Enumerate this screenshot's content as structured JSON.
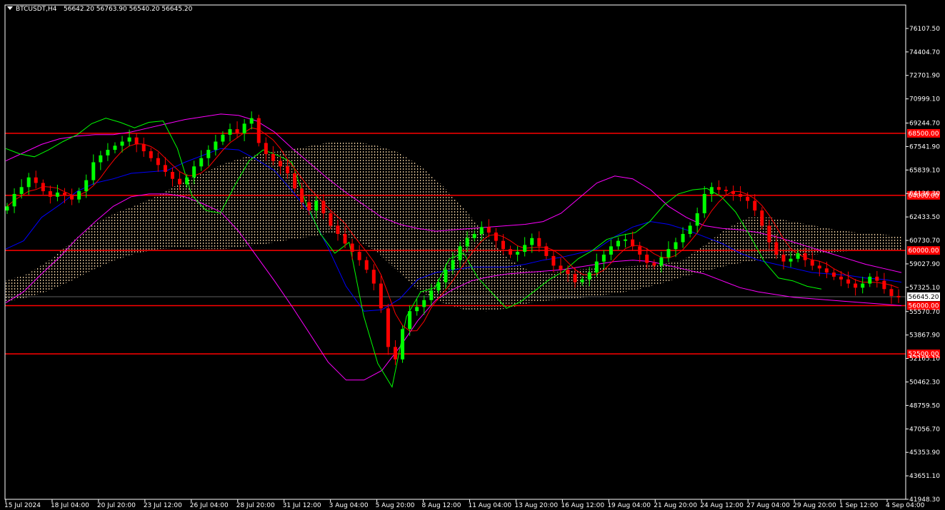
{
  "header": {
    "symbol": "BTCUSDT,H4",
    "ohlc": "56642.20 56763.90 56540.20 56645.20"
  },
  "colors": {
    "background": "#000000",
    "axis": "#ffffff",
    "bull_candle": "#00ff00",
    "bear_candle": "#ff0000",
    "level_line": "#ff0000",
    "bollinger": "#ff00ff",
    "kijun": "#0000ff",
    "tenkan": "#ff0000",
    "chikou": "#00ff00",
    "kumo": "#ffdead"
  },
  "chart_data": {
    "type": "candlestick",
    "ylim": [
      41948.3,
      77810.2
    ],
    "y_ticks": [
      "76107.50",
      "74404.70",
      "72701.90",
      "70999.10",
      "69244.70",
      "67541.90",
      "65839.10",
      "64136.30",
      "62433.50",
      "60730.70",
      "59027.90",
      "57325.10",
      "55570.70",
      "53867.90",
      "52165.10",
      "50462.30",
      "48759.50",
      "47056.70",
      "45353.90",
      "43651.10",
      "41948.30"
    ],
    "x_ticks": [
      "15 Jul 2024",
      "18 Jul 04:00",
      "20 Jul 20:00",
      "23 Jul 12:00",
      "26 Jul 04:00",
      "28 Jul 20:00",
      "31 Jul 12:00",
      "3 Aug 04:00",
      "5 Aug 20:00",
      "8 Aug 12:00",
      "11 Aug 04:00",
      "13 Aug 20:00",
      "16 Aug 12:00",
      "19 Aug 04:00",
      "21 Aug 20:00",
      "24 Aug 12:00",
      "27 Aug 04:00",
      "29 Aug 20:00",
      "1 Sep 12:00",
      "4 Sep 04:00"
    ],
    "levels": [
      {
        "label": "68500.00",
        "value": 68500
      },
      {
        "label": "64000.00",
        "value": 64000
      },
      {
        "label": "60000.00",
        "value": 60000
      },
      {
        "label": "56000.00",
        "value": 56000
      },
      {
        "label": "52500.00",
        "value": 52500
      }
    ],
    "current_price": {
      "label": "56645.20",
      "value": 56645.2
    },
    "close_series": [
      63200,
      64100,
      64600,
      65300,
      64900,
      64300,
      63900,
      64200,
      64000,
      63700,
      64300,
      65100,
      66400,
      66900,
      67300,
      67600,
      67900,
      68200,
      67700,
      67200,
      66700,
      66200,
      65700,
      65200,
      64800,
      65300,
      66100,
      66700,
      67300,
      67900,
      68400,
      68800,
      68500,
      69200,
      69600,
      67800,
      67000,
      66500,
      66100,
      65600,
      64500,
      63500,
      62900,
      63600,
      62700,
      61800,
      61200,
      60500,
      59900,
      59300,
      58600,
      57600,
      55800,
      53000,
      52100,
      54300,
      55600,
      55900,
      56400,
      57100,
      57700,
      58600,
      59300,
      60300,
      60900,
      61200,
      61700,
      61300,
      60700,
      60100,
      59700,
      59900,
      60400,
      60900,
      60300,
      59600,
      58900,
      58600,
      58300,
      57700,
      57900,
      58400,
      59200,
      59700,
      60300,
      60700,
      60800,
      60300,
      59700,
      59100,
      58900,
      59500,
      60100,
      60600,
      61200,
      61800,
      62700,
      64100,
      64600,
      64400,
      64300,
      64100,
      63900,
      63600,
      62900,
      61800,
      60600,
      59700,
      59200,
      59400,
      59800,
      59300,
      58900,
      58700,
      58400,
      58100,
      57900,
      57600,
      57300,
      57600,
      58100,
      57800,
      57200,
      56700,
      56600
    ],
    "series": [
      {
        "name": "",
        "role": "bollinger-upper",
        "values": [
          66500,
          67100,
          67700,
          68100,
          68300,
          68400,
          68400,
          68600,
          68900,
          69200,
          69500,
          69700,
          69900,
          69800,
          69400,
          68600,
          67400,
          66300,
          65200,
          64200,
          63300,
          62400,
          61900,
          61600,
          61400,
          61500,
          61600,
          61700,
          61800,
          61900,
          62100,
          62700,
          63800,
          64900,
          65400,
          65200,
          64400,
          63200,
          62400,
          61800,
          61600,
          61500,
          61300,
          61000,
          60600,
          60200,
          59800,
          59400,
          59000,
          58700,
          58400
        ]
      },
      {
        "name": "",
        "role": "bollinger-lower",
        "values": [
          56200,
          57000,
          58300,
          59500,
          60900,
          62100,
          63200,
          63900,
          64100,
          64100,
          63900,
          63400,
          62800,
          61400,
          59600,
          57800,
          55900,
          53900,
          51900,
          50600,
          50600,
          51300,
          53000,
          54900,
          56400,
          57200,
          57800,
          58100,
          58300,
          58400,
          58500,
          58600,
          58800,
          59000,
          59200,
          59300,
          59200,
          58900,
          58600,
          58300,
          57800,
          57300,
          57000,
          56800,
          56600,
          56500,
          56400,
          56300,
          56200,
          56100,
          56000
        ]
      },
      {
        "name": "",
        "role": "kijun",
        "values": [
          60100,
          60700,
          62400,
          63300,
          64300,
          64900,
          65200,
          65600,
          65700,
          65800,
          66400,
          66900,
          67400,
          67300,
          66600,
          65800,
          64300,
          62700,
          60200,
          57400,
          55600,
          55700,
          56500,
          57900,
          58400,
          58600,
          58800,
          58800,
          58800,
          59000,
          59300,
          59500,
          59800,
          60100,
          61000,
          61700,
          62100,
          61900,
          61500,
          61000,
          60500,
          59800,
          59300,
          59000,
          58700,
          58400,
          58300,
          58200,
          58000,
          57900,
          57700
        ]
      },
      {
        "name": "",
        "role": "chikou",
        "values": [
          67400,
          67000,
          66800,
          67300,
          67900,
          68400,
          69200,
          69600,
          69300,
          68900,
          69300,
          69400,
          67400,
          64000,
          62900,
          62700,
          64700,
          66500,
          67300,
          66900,
          66400,
          63400,
          61200,
          59800,
          60600,
          55300,
          51800,
          50100,
          55200,
          57000,
          57300,
          59400,
          59800,
          58000,
          56900,
          55800,
          56300,
          57100,
          57900,
          58500,
          59400,
          60000,
          60800,
          61100,
          61300,
          62100,
          63300,
          64100,
          64400,
          64500,
          63900,
          62800,
          61100,
          59200,
          58000,
          57800,
          57400,
          57200
        ]
      },
      {
        "name": "",
        "role": "kumo-top",
        "values": [
          57800,
          58300,
          59300,
          60600,
          61900,
          62700,
          63300,
          64000,
          64900,
          65600,
          66300,
          66800,
          67100,
          67300,
          67600,
          67900,
          67900,
          67600,
          67100,
          66100,
          64700,
          63000,
          61100,
          59400,
          58500,
          58400,
          58600,
          58700,
          58800,
          58900,
          59000,
          59300,
          60400,
          61600,
          62400,
          62400,
          62100,
          61800,
          61500,
          61300,
          61200,
          61000
        ]
      },
      {
        "name": "",
        "role": "kumo-bottom",
        "values": [
          56300,
          56600,
          57100,
          57800,
          58600,
          59300,
          59800,
          60100,
          60200,
          60100,
          60100,
          60300,
          60500,
          60800,
          61000,
          61300,
          60800,
          59900,
          58400,
          57000,
          56200,
          55700,
          55600,
          55800,
          56200,
          56400,
          56500,
          56700,
          56900,
          57200,
          57600,
          58100,
          58500,
          58900,
          59200,
          59400,
          59600,
          59700,
          59900,
          60000,
          60000,
          60000
        ]
      }
    ]
  }
}
